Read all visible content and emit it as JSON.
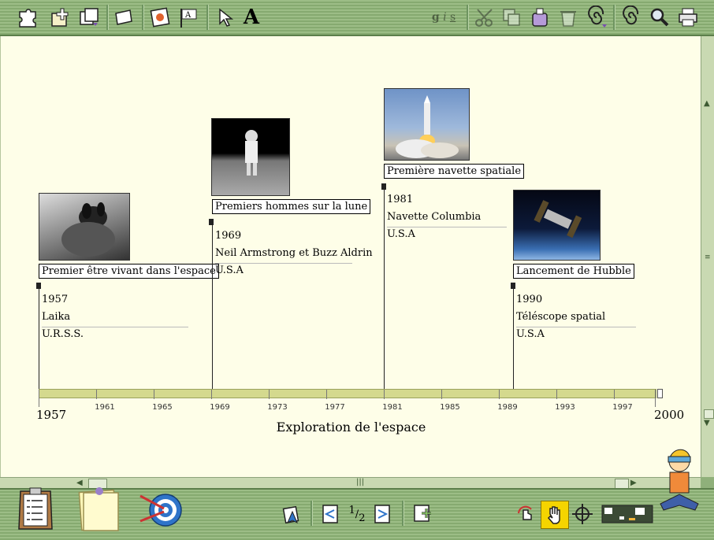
{
  "timeline": {
    "title": "Exploration de l'espace",
    "start_label": "1957",
    "end_label": "2000",
    "ticks": [
      "1961",
      "1965",
      "1969",
      "1973",
      "1977",
      "1981",
      "1985",
      "1989",
      "1993",
      "1997"
    ]
  },
  "events": [
    {
      "title": "Premier être vivant dans l'espace",
      "year": "1957",
      "name": "Laika",
      "country": "U.R.S.S."
    },
    {
      "title": "Premiers hommes sur la lune",
      "year": "1969",
      "name": "Neil Armstrong et Buzz Aldrin",
      "country": "U.S.A"
    },
    {
      "title": "Première navette spatiale",
      "year": "1981",
      "name": "Navette Columbia",
      "country": "U.S.A"
    },
    {
      "title": "Lancement de Hubble",
      "year": "1990",
      "name": "Téléscope spatial",
      "country": "U.S.A"
    }
  ],
  "toolbar": {
    "text_style": {
      "bold_g": "g",
      "italic_i": "i",
      "underline_s": "s"
    },
    "text_tool_glyph": "A"
  },
  "pager": {
    "current": "1",
    "total": "2"
  },
  "colors": {
    "canvas": "#fefee8",
    "toolbar": "#8fb07a",
    "axis": "#d4d98e",
    "active_tool": "#f5d400"
  }
}
